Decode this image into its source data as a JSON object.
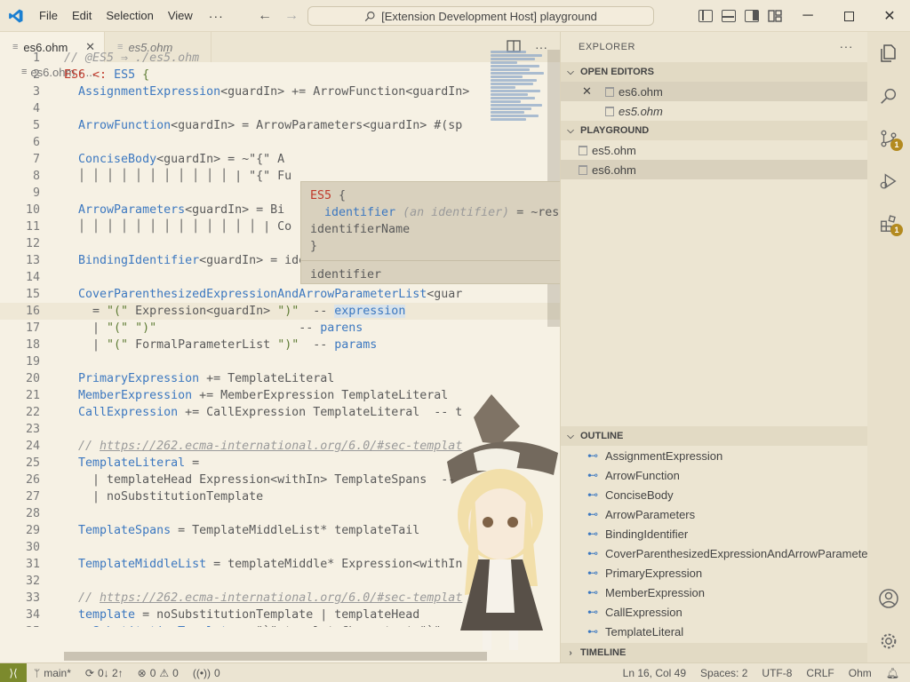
{
  "titlebar": {
    "menu": [
      "File",
      "Edit",
      "Selection",
      "View"
    ],
    "more": "···",
    "command_center": "[Extension Development Host] playground"
  },
  "tabs": [
    {
      "label": "es6.ohm",
      "active": true
    },
    {
      "label": "es5.ohm",
      "active": false
    }
  ],
  "breadcrumb": {
    "file": "es6.ohm",
    "rest": "..."
  },
  "code_lines": [
    {
      "n": "1",
      "html": "<span class='cm'>// @ES5 ⇒ ./es5.ohm</span>"
    },
    {
      "n": "2",
      "html": "<span class='kw'>ES6</span> <span class='kw'>&lt;:</span> <span class='rule'>ES5</span> <span class='str'>{</span>"
    },
    {
      "n": "3",
      "html": "  <span class='rule'>AssignmentExpression</span>&lt;guardIn&gt; += ArrowFunction&lt;guardIn&gt;"
    },
    {
      "n": "4",
      "html": ""
    },
    {
      "n": "5",
      "html": "  <span class='rule'>ArrowFunction</span>&lt;guardIn&gt; = ArrowParameters&lt;guardIn&gt; #(sp"
    },
    {
      "n": "6",
      "html": ""
    },
    {
      "n": "7",
      "html": "  <span class='rule'>ConciseBody</span>&lt;guardIn&gt; = ~\"{\" A"
    },
    {
      "n": "8",
      "html": "  │ │ │ │ │ │ │ │ │ │ │ | \"{\" Fu"
    },
    {
      "n": "9",
      "html": ""
    },
    {
      "n": "10",
      "html": "  <span class='rule'>ArrowParameters</span>&lt;guardIn&gt; = Bi"
    },
    {
      "n": "11",
      "html": "  │ │ │ │ │ │ │ │ │ │ │ │ │ | Co"
    },
    {
      "n": "12",
      "html": ""
    },
    {
      "n": "13",
      "html": "  <span class='rule'>BindingIdentifier</span>&lt;guardIn&gt; = identifier  <span class='cm'>// TODO: Impl</span>"
    },
    {
      "n": "14",
      "html": ""
    },
    {
      "n": "15",
      "html": "  <span class='rule'>CoverParenthesizedExpressionAndArrowParameterList</span>&lt;guar"
    },
    {
      "n": "16",
      "html": "    = <span class='str'>\"(\"</span> Expression&lt;guardIn&gt; <span class='str'>\")\"</span>  -- <span class='rule hl'>expression</span>"
    },
    {
      "n": "17",
      "html": "    | <span class='str'>\"(\"</span> <span class='str'>\")\"</span>                    -- <span class='rule'>parens</span>"
    },
    {
      "n": "18",
      "html": "    | <span class='str'>\"(\"</span> FormalParameterList <span class='str'>\")\"</span>  -- <span class='rule'>params</span>"
    },
    {
      "n": "19",
      "html": ""
    },
    {
      "n": "20",
      "html": "  <span class='rule'>PrimaryExpression</span> += TemplateLiteral"
    },
    {
      "n": "21",
      "html": "  <span class='rule'>MemberExpression</span> += MemberExpression TemplateLiteral"
    },
    {
      "n": "22",
      "html": "  <span class='rule'>CallExpression</span> += CallExpression TemplateLiteral  -- t"
    },
    {
      "n": "23",
      "html": ""
    },
    {
      "n": "24",
      "html": "  <span class='cm'>// <u>https://262.ecma-international.org/6.0/#sec-templat</u></span>"
    },
    {
      "n": "25",
      "html": "  <span class='rule'>TemplateLiteral</span> ="
    },
    {
      "n": "26",
      "html": "    | templateHead Expression&lt;withIn&gt; TemplateSpans  --"
    },
    {
      "n": "27",
      "html": "    | noSubstitutionTemplate"
    },
    {
      "n": "28",
      "html": ""
    },
    {
      "n": "29",
      "html": "  <span class='rule'>TemplateSpans</span> = TemplateMiddleList* templateTail"
    },
    {
      "n": "30",
      "html": ""
    },
    {
      "n": "31",
      "html": "  <span class='rule'>TemplateMiddleList</span> = templateMiddle* Expression&lt;withIn"
    },
    {
      "n": "32",
      "html": ""
    },
    {
      "n": "33",
      "html": "  <span class='cm'>// <u>https://262.ecma-international.org/6.0/#sec-templat</u></span>"
    },
    {
      "n": "34",
      "html": "  <span class='rule'>template</span> = noSubstitutionTemplate | templateHead"
    },
    {
      "n": "35",
      "html": "  <span class='rule'>noSubstitutionTemplate</span> = \"`\" templateCharacter* \"`\""
    }
  ],
  "hover": {
    "lines": [
      "<span class='kw'>ES5</span> {",
      "  <span class='rule'>identifier</span> <span class='cm'>(an identifier)</span> = ~reservedWord",
      "identifierName",
      "}"
    ],
    "footer": "identifier"
  },
  "explorer": {
    "title": "EXPLORER",
    "open_editors_label": "OPEN EDITORS",
    "open_editors": [
      {
        "label": "es6.ohm",
        "italic": false,
        "selected": true
      },
      {
        "label": "es5.ohm",
        "italic": true,
        "selected": false
      }
    ],
    "folder_label": "PLAYGROUND",
    "files": [
      {
        "label": "es5.ohm",
        "selected": false
      },
      {
        "label": "es6.ohm",
        "selected": true
      }
    ],
    "outline_label": "OUTLINE",
    "outline": [
      "AssignmentExpression",
      "ArrowFunction",
      "ConciseBody",
      "ArrowParameters",
      "BindingIdentifier",
      "CoverParenthesizedExpressionAndArrowParamete...",
      "PrimaryExpression",
      "MemberExpression",
      "CallExpression",
      "TemplateLiteral"
    ],
    "timeline_label": "TIMELINE"
  },
  "activity_badges": {
    "source_control": "1",
    "extensions": "1"
  },
  "statusbar": {
    "branch": "main*",
    "sync": "0↓ 2↑",
    "errors": "0",
    "warnings": "0",
    "ports": "0",
    "position": "Ln 16, Col 49",
    "spaces": "Spaces: 2",
    "encoding": "UTF-8",
    "eol": "CRLF",
    "language": "Ohm"
  },
  "colors": {
    "accent": "#3c78c0",
    "keyword": "#c0392b",
    "string": "#5e7c35",
    "remote": "#7c8a2d"
  }
}
